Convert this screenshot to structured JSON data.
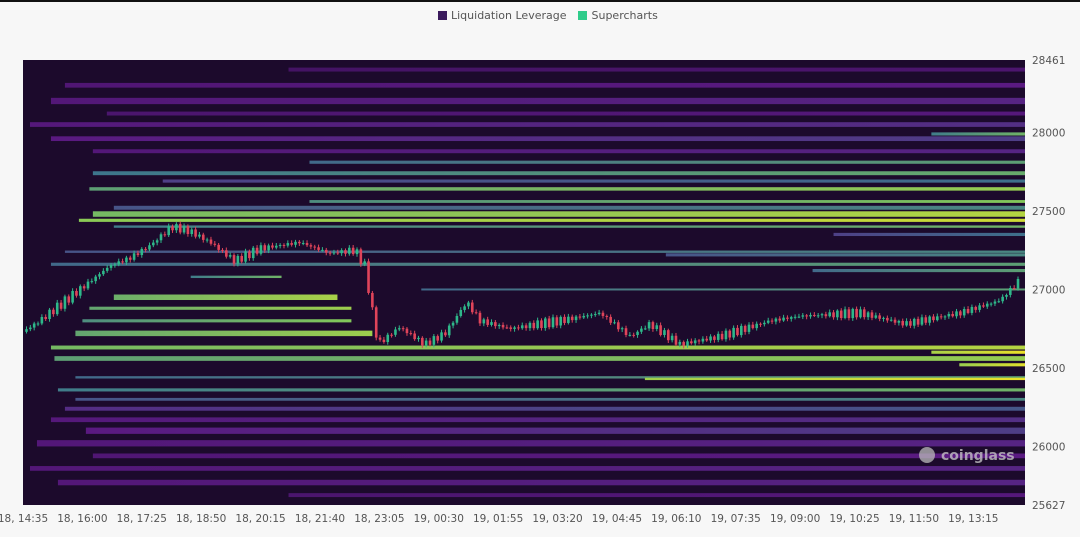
{
  "legend": [
    {
      "label": "Liquidation Leverage",
      "color": "#3a1a5c"
    },
    {
      "label": "Supercharts",
      "color": "#2ecc8a"
    }
  ],
  "watermark": "coinglass",
  "chart_data": {
    "type": "heatmap",
    "title": "",
    "ylim": [
      25627,
      28461
    ],
    "y_ticks": [
      "28461",
      "28000",
      "27500",
      "27000",
      "26500",
      "26000",
      "25627"
    ],
    "y_tick_values": [
      28461,
      28000,
      27500,
      27000,
      26500,
      26000,
      25627
    ],
    "x_ticks": [
      "18, 14:35",
      "18, 16:00",
      "18, 17:25",
      "18, 18:50",
      "18, 20:15",
      "18, 21:40",
      "18, 23:05",
      "19, 00:30",
      "19, 01:55",
      "19, 03:20",
      "19, 04:45",
      "19, 06:10",
      "19, 07:35",
      "19, 09:00",
      "19, 10:25",
      "19, 11:50",
      "19, 13:15"
    ],
    "x_tick_step_minutes": 85,
    "x_range_minutes": [
      0,
      1434
    ],
    "bands": [
      {
        "price": 28400,
        "h": 25,
        "from": 380,
        "level": 0.2
      },
      {
        "price": 28300,
        "h": 30,
        "from": 60,
        "level": 0.28
      },
      {
        "price": 28200,
        "h": 40,
        "from": 40,
        "level": 0.3
      },
      {
        "price": 28120,
        "h": 25,
        "from": 120,
        "level": 0.25
      },
      {
        "price": 28050,
        "h": 30,
        "from": 10,
        "level": 0.32
      },
      {
        "price": 27960,
        "h": 30,
        "from": 40,
        "level": 0.35
      },
      {
        "price": 27990,
        "h": 20,
        "from": 1300,
        "level": 0.6
      },
      {
        "price": 27880,
        "h": 25,
        "from": 100,
        "level": 0.3
      },
      {
        "price": 27810,
        "h": 20,
        "from": 410,
        "level": 0.55
      },
      {
        "price": 27740,
        "h": 25,
        "from": 100,
        "level": 0.58
      },
      {
        "price": 27690,
        "h": 20,
        "from": 200,
        "level": 0.45
      },
      {
        "price": 27640,
        "h": 22,
        "from": 95,
        "level": 0.7
      },
      {
        "price": 27560,
        "h": 18,
        "from": 410,
        "level": 0.65
      },
      {
        "price": 27520,
        "h": 25,
        "from": 130,
        "level": 0.5
      },
      {
        "price": 27480,
        "h": 35,
        "from": 100,
        "level": 0.78
      },
      {
        "price": 27440,
        "h": 20,
        "from": 80,
        "level": 0.85
      },
      {
        "price": 27400,
        "h": 15,
        "from": 130,
        "level": 0.6
      },
      {
        "price": 27350,
        "h": 20,
        "from": 1160,
        "level": 0.45
      },
      {
        "price": 27240,
        "h": 15,
        "from": 60,
        "level": 0.5
      },
      {
        "price": 27220,
        "h": 20,
        "from": 920,
        "level": 0.5
      },
      {
        "price": 27160,
        "h": 20,
        "from": 40,
        "level": 0.55
      },
      {
        "price": 27120,
        "h": 20,
        "from": 1130,
        "level": 0.55
      },
      {
        "price": 27080,
        "h": 15,
        "from": 240,
        "level": 0.6,
        "to": 370
      },
      {
        "price": 27000,
        "h": 12,
        "from": 570,
        "level": 0.55
      },
      {
        "price": 26950,
        "h": 35,
        "from": 130,
        "level": 0.75,
        "to": 450
      },
      {
        "price": 26880,
        "h": 20,
        "from": 95,
        "level": 0.72,
        "to": 470
      },
      {
        "price": 26800,
        "h": 20,
        "from": 85,
        "level": 0.65,
        "to": 470
      },
      {
        "price": 26720,
        "h": 35,
        "from": 75,
        "level": 0.72,
        "to": 500
      },
      {
        "price": 26630,
        "h": 25,
        "from": 40,
        "level": 0.78
      },
      {
        "price": 26600,
        "h": 20,
        "from": 1300,
        "level": 0.95
      },
      {
        "price": 26560,
        "h": 30,
        "from": 45,
        "level": 0.7
      },
      {
        "price": 26520,
        "h": 20,
        "from": 1340,
        "level": 0.9
      },
      {
        "price": 26440,
        "h": 15,
        "from": 75,
        "level": 0.55
      },
      {
        "price": 26430,
        "h": 15,
        "from": 890,
        "level": 0.92
      },
      {
        "price": 26360,
        "h": 20,
        "from": 50,
        "level": 0.6
      },
      {
        "price": 26300,
        "h": 18,
        "from": 75,
        "level": 0.5
      },
      {
        "price": 26240,
        "h": 25,
        "from": 60,
        "level": 0.4
      },
      {
        "price": 26170,
        "h": 30,
        "from": 40,
        "level": 0.32
      },
      {
        "price": 26100,
        "h": 40,
        "from": 90,
        "level": 0.35
      },
      {
        "price": 26020,
        "h": 40,
        "from": 20,
        "level": 0.3
      },
      {
        "price": 25940,
        "h": 30,
        "from": 100,
        "level": 0.28
      },
      {
        "price": 25860,
        "h": 30,
        "from": 10,
        "level": 0.3
      },
      {
        "price": 25770,
        "h": 35,
        "from": 50,
        "level": 0.3
      },
      {
        "price": 25690,
        "h": 25,
        "from": 380,
        "level": 0.25
      }
    ],
    "price_path": [
      [
        0,
        26730
      ],
      [
        24,
        26800
      ],
      [
        67,
        26950
      ],
      [
        96,
        27050
      ],
      [
        124,
        27150
      ],
      [
        153,
        27200
      ],
      [
        182,
        27280
      ],
      [
        213,
        27400
      ],
      [
        239,
        27370
      ],
      [
        268,
        27300
      ],
      [
        303,
        27180
      ],
      [
        339,
        27260
      ],
      [
        396,
        27300
      ],
      [
        439,
        27230
      ],
      [
        475,
        27250
      ],
      [
        489,
        27150
      ],
      [
        508,
        26650
      ],
      [
        539,
        26760
      ],
      [
        575,
        26650
      ],
      [
        604,
        26720
      ],
      [
        635,
        26920
      ],
      [
        654,
        26800
      ],
      [
        697,
        26750
      ],
      [
        768,
        26800
      ],
      [
        826,
        26850
      ],
      [
        869,
        26700
      ],
      [
        897,
        26780
      ],
      [
        940,
        26650
      ],
      [
        997,
        26700
      ],
      [
        1069,
        26800
      ],
      [
        1112,
        26830
      ],
      [
        1198,
        26850
      ],
      [
        1262,
        26780
      ],
      [
        1341,
        26850
      ],
      [
        1398,
        26930
      ],
      [
        1427,
        27060
      ]
    ]
  }
}
